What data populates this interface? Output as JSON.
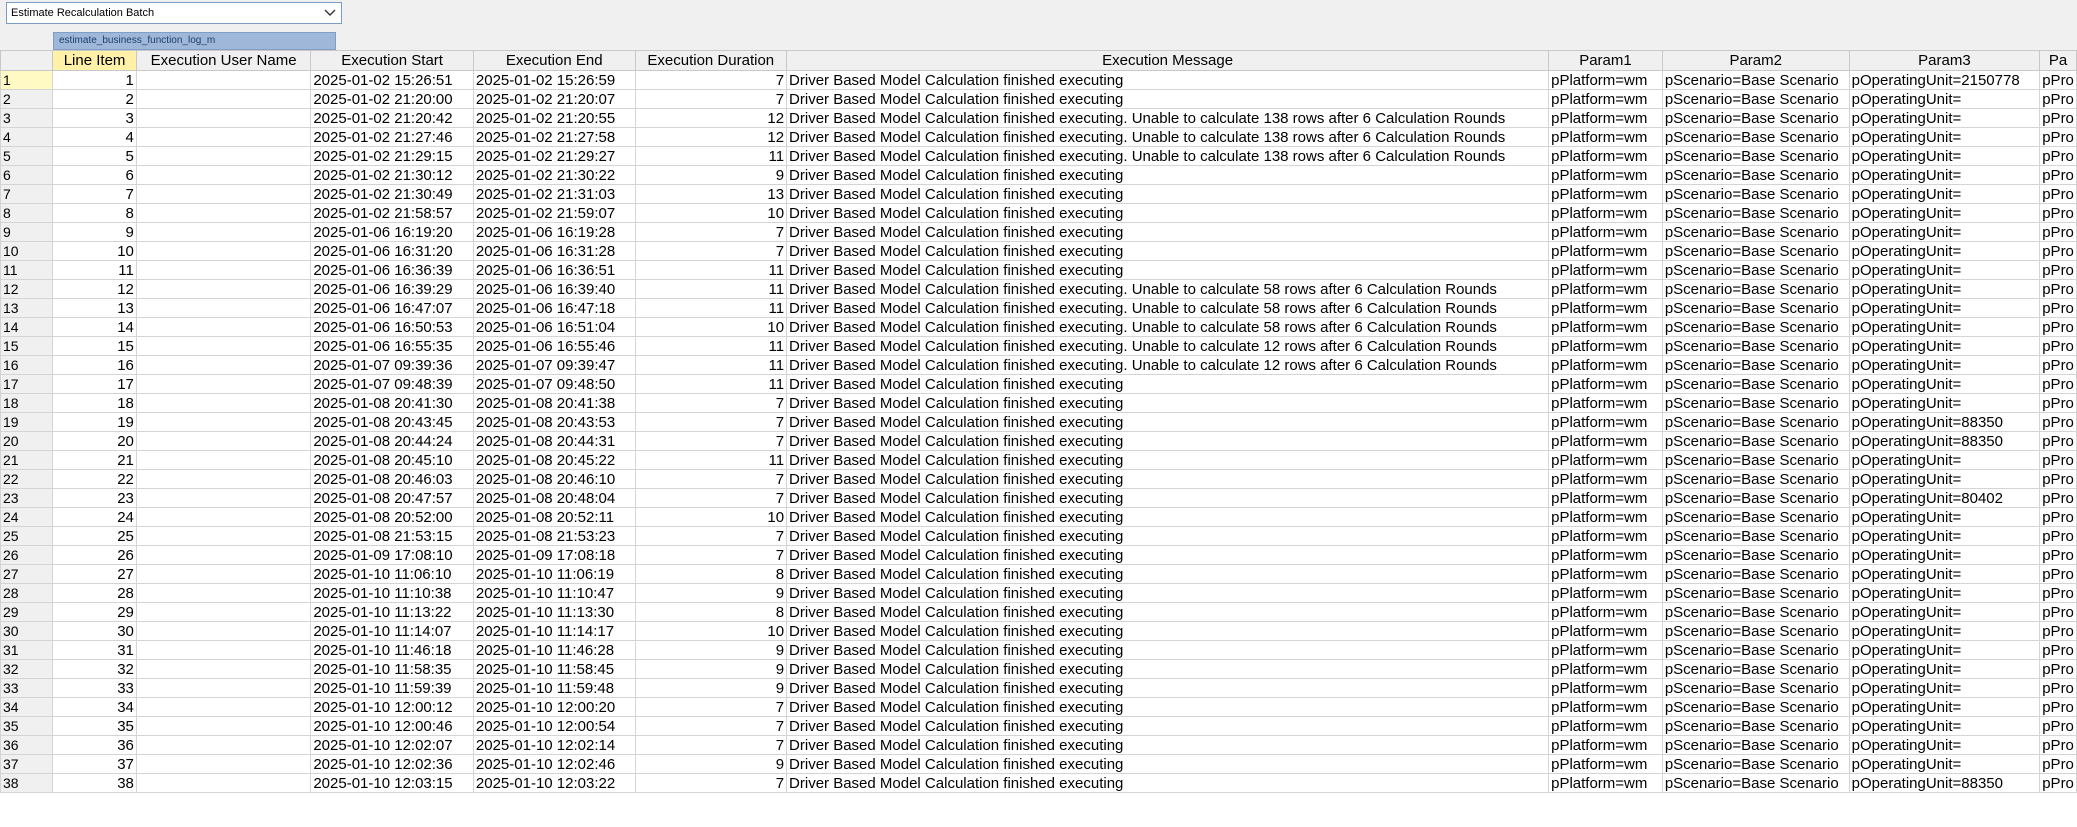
{
  "combo": {
    "value": "Estimate Recalculation Batch"
  },
  "sheet_tab": {
    "label": "estimate_business_function_log_m"
  },
  "columns": [
    "",
    "Line Item",
    "Execution User Name",
    "Execution Start",
    "Execution End",
    "Execution Duration",
    "Execution Message",
    "Param1",
    "Param2",
    "Param3",
    "Pa"
  ],
  "rows": [
    [
      "1",
      "1",
      "",
      "2025-01-02 15:26:51",
      "2025-01-02 15:26:59",
      "7",
      "Driver Based Model Calculation finished executing",
      "pPlatform=wm",
      "pScenario=Base Scenario",
      "pOperatingUnit=2150778",
      "pPro"
    ],
    [
      "2",
      "2",
      "",
      "2025-01-02 21:20:00",
      "2025-01-02 21:20:07",
      "7",
      "Driver Based Model Calculation finished executing",
      "pPlatform=wm",
      "pScenario=Base Scenario",
      "pOperatingUnit=",
      "pPro"
    ],
    [
      "3",
      "3",
      "",
      "2025-01-02 21:20:42",
      "2025-01-02 21:20:55",
      "12",
      "Driver Based Model Calculation finished executing. Unable to calculate 138 rows after 6 Calculation Rounds",
      "pPlatform=wm",
      "pScenario=Base Scenario",
      "pOperatingUnit=",
      "pPro"
    ],
    [
      "4",
      "4",
      "",
      "2025-01-02 21:27:46",
      "2025-01-02 21:27:58",
      "12",
      "Driver Based Model Calculation finished executing. Unable to calculate 138 rows after 6 Calculation Rounds",
      "pPlatform=wm",
      "pScenario=Base Scenario",
      "pOperatingUnit=",
      "pPro"
    ],
    [
      "5",
      "5",
      "",
      "2025-01-02 21:29:15",
      "2025-01-02 21:29:27",
      "11",
      "Driver Based Model Calculation finished executing. Unable to calculate 138 rows after 6 Calculation Rounds",
      "pPlatform=wm",
      "pScenario=Base Scenario",
      "pOperatingUnit=",
      "pPro"
    ],
    [
      "6",
      "6",
      "",
      "2025-01-02 21:30:12",
      "2025-01-02 21:30:22",
      "9",
      "Driver Based Model Calculation finished executing",
      "pPlatform=wm",
      "pScenario=Base Scenario",
      "pOperatingUnit=",
      "pPro"
    ],
    [
      "7",
      "7",
      "",
      "2025-01-02 21:30:49",
      "2025-01-02 21:31:03",
      "13",
      "Driver Based Model Calculation finished executing",
      "pPlatform=wm",
      "pScenario=Base Scenario",
      "pOperatingUnit=",
      "pPro"
    ],
    [
      "8",
      "8",
      "",
      "2025-01-02 21:58:57",
      "2025-01-02 21:59:07",
      "10",
      "Driver Based Model Calculation finished executing",
      "pPlatform=wm",
      "pScenario=Base Scenario",
      "pOperatingUnit=",
      "pPro"
    ],
    [
      "9",
      "9",
      "",
      "2025-01-06 16:19:20",
      "2025-01-06 16:19:28",
      "7",
      "Driver Based Model Calculation finished executing",
      "pPlatform=wm",
      "pScenario=Base Scenario",
      "pOperatingUnit=",
      "pPro"
    ],
    [
      "10",
      "10",
      "",
      "2025-01-06 16:31:20",
      "2025-01-06 16:31:28",
      "7",
      "Driver Based Model Calculation finished executing",
      "pPlatform=wm",
      "pScenario=Base Scenario",
      "pOperatingUnit=",
      "pPro"
    ],
    [
      "11",
      "11",
      "",
      "2025-01-06 16:36:39",
      "2025-01-06 16:36:51",
      "11",
      "Driver Based Model Calculation finished executing",
      "pPlatform=wm",
      "pScenario=Base Scenario",
      "pOperatingUnit=",
      "pPro"
    ],
    [
      "12",
      "12",
      "",
      "2025-01-06 16:39:29",
      "2025-01-06 16:39:40",
      "11",
      "Driver Based Model Calculation finished executing. Unable to calculate 58 rows after 6 Calculation Rounds",
      "pPlatform=wm",
      "pScenario=Base Scenario",
      "pOperatingUnit=",
      "pPro"
    ],
    [
      "13",
      "13",
      "",
      "2025-01-06 16:47:07",
      "2025-01-06 16:47:18",
      "11",
      "Driver Based Model Calculation finished executing. Unable to calculate 58 rows after 6 Calculation Rounds",
      "pPlatform=wm",
      "pScenario=Base Scenario",
      "pOperatingUnit=",
      "pPro"
    ],
    [
      "14",
      "14",
      "",
      "2025-01-06 16:50:53",
      "2025-01-06 16:51:04",
      "10",
      "Driver Based Model Calculation finished executing. Unable to calculate 58 rows after 6 Calculation Rounds",
      "pPlatform=wm",
      "pScenario=Base Scenario",
      "pOperatingUnit=",
      "pPro"
    ],
    [
      "15",
      "15",
      "",
      "2025-01-06 16:55:35",
      "2025-01-06 16:55:46",
      "11",
      "Driver Based Model Calculation finished executing. Unable to calculate 12 rows after 6 Calculation Rounds",
      "pPlatform=wm",
      "pScenario=Base Scenario",
      "pOperatingUnit=",
      "pPro"
    ],
    [
      "16",
      "16",
      "",
      "2025-01-07 09:39:36",
      "2025-01-07 09:39:47",
      "11",
      "Driver Based Model Calculation finished executing. Unable to calculate 12 rows after 6 Calculation Rounds",
      "pPlatform=wm",
      "pScenario=Base Scenario",
      "pOperatingUnit=",
      "pPro"
    ],
    [
      "17",
      "17",
      "",
      "2025-01-07 09:48:39",
      "2025-01-07 09:48:50",
      "11",
      "Driver Based Model Calculation finished executing",
      "pPlatform=wm",
      "pScenario=Base Scenario",
      "pOperatingUnit=",
      "pPro"
    ],
    [
      "18",
      "18",
      "",
      "2025-01-08 20:41:30",
      "2025-01-08 20:41:38",
      "7",
      "Driver Based Model Calculation finished executing",
      "pPlatform=wm",
      "pScenario=Base Scenario",
      "pOperatingUnit=",
      "pPro"
    ],
    [
      "19",
      "19",
      "",
      "2025-01-08 20:43:45",
      "2025-01-08 20:43:53",
      "7",
      "Driver Based Model Calculation finished executing",
      "pPlatform=wm",
      "pScenario=Base Scenario",
      "pOperatingUnit=88350",
      "pPro"
    ],
    [
      "20",
      "20",
      "",
      "2025-01-08 20:44:24",
      "2025-01-08 20:44:31",
      "7",
      "Driver Based Model Calculation finished executing",
      "pPlatform=wm",
      "pScenario=Base Scenario",
      "pOperatingUnit=88350",
      "pPro"
    ],
    [
      "21",
      "21",
      "",
      "2025-01-08 20:45:10",
      "2025-01-08 20:45:22",
      "11",
      "Driver Based Model Calculation finished executing",
      "pPlatform=wm",
      "pScenario=Base Scenario",
      "pOperatingUnit=",
      "pPro"
    ],
    [
      "22",
      "22",
      "",
      "2025-01-08 20:46:03",
      "2025-01-08 20:46:10",
      "7",
      "Driver Based Model Calculation finished executing",
      "pPlatform=wm",
      "pScenario=Base Scenario",
      "pOperatingUnit=",
      "pPro"
    ],
    [
      "23",
      "23",
      "",
      "2025-01-08 20:47:57",
      "2025-01-08 20:48:04",
      "7",
      "Driver Based Model Calculation finished executing",
      "pPlatform=wm",
      "pScenario=Base Scenario",
      "pOperatingUnit=80402",
      "pPro"
    ],
    [
      "24",
      "24",
      "",
      "2025-01-08 20:52:00",
      "2025-01-08 20:52:11",
      "10",
      "Driver Based Model Calculation finished executing",
      "pPlatform=wm",
      "pScenario=Base Scenario",
      "pOperatingUnit=",
      "pPro"
    ],
    [
      "25",
      "25",
      "",
      "2025-01-08 21:53:15",
      "2025-01-08 21:53:23",
      "7",
      "Driver Based Model Calculation finished executing",
      "pPlatform=wm",
      "pScenario=Base Scenario",
      "pOperatingUnit=",
      "pPro"
    ],
    [
      "26",
      "26",
      "",
      "2025-01-09 17:08:10",
      "2025-01-09 17:08:18",
      "7",
      "Driver Based Model Calculation finished executing",
      "pPlatform=wm",
      "pScenario=Base Scenario",
      "pOperatingUnit=",
      "pPro"
    ],
    [
      "27",
      "27",
      "",
      "2025-01-10 11:06:10",
      "2025-01-10 11:06:19",
      "8",
      "Driver Based Model Calculation finished executing",
      "pPlatform=wm",
      "pScenario=Base Scenario",
      "pOperatingUnit=",
      "pPro"
    ],
    [
      "28",
      "28",
      "",
      "2025-01-10 11:10:38",
      "2025-01-10 11:10:47",
      "9",
      "Driver Based Model Calculation finished executing",
      "pPlatform=wm",
      "pScenario=Base Scenario",
      "pOperatingUnit=",
      "pPro"
    ],
    [
      "29",
      "29",
      "",
      "2025-01-10 11:13:22",
      "2025-01-10 11:13:30",
      "8",
      "Driver Based Model Calculation finished executing",
      "pPlatform=wm",
      "pScenario=Base Scenario",
      "pOperatingUnit=",
      "pPro"
    ],
    [
      "30",
      "30",
      "",
      "2025-01-10 11:14:07",
      "2025-01-10 11:14:17",
      "10",
      "Driver Based Model Calculation finished executing",
      "pPlatform=wm",
      "pScenario=Base Scenario",
      "pOperatingUnit=",
      "pPro"
    ],
    [
      "31",
      "31",
      "",
      "2025-01-10 11:46:18",
      "2025-01-10 11:46:28",
      "9",
      "Driver Based Model Calculation finished executing",
      "pPlatform=wm",
      "pScenario=Base Scenario",
      "pOperatingUnit=",
      "pPro"
    ],
    [
      "32",
      "32",
      "",
      "2025-01-10 11:58:35",
      "2025-01-10 11:58:45",
      "9",
      "Driver Based Model Calculation finished executing",
      "pPlatform=wm",
      "pScenario=Base Scenario",
      "pOperatingUnit=",
      "pPro"
    ],
    [
      "33",
      "33",
      "",
      "2025-01-10 11:59:39",
      "2025-01-10 11:59:48",
      "9",
      "Driver Based Model Calculation finished executing",
      "pPlatform=wm",
      "pScenario=Base Scenario",
      "pOperatingUnit=",
      "pPro"
    ],
    [
      "34",
      "34",
      "",
      "2025-01-10 12:00:12",
      "2025-01-10 12:00:20",
      "7",
      "Driver Based Model Calculation finished executing",
      "pPlatform=wm",
      "pScenario=Base Scenario",
      "pOperatingUnit=",
      "pPro"
    ],
    [
      "35",
      "35",
      "",
      "2025-01-10 12:00:46",
      "2025-01-10 12:00:54",
      "7",
      "Driver Based Model Calculation finished executing",
      "pPlatform=wm",
      "pScenario=Base Scenario",
      "pOperatingUnit=",
      "pPro"
    ],
    [
      "36",
      "36",
      "",
      "2025-01-10 12:02:07",
      "2025-01-10 12:02:14",
      "7",
      "Driver Based Model Calculation finished executing",
      "pPlatform=wm",
      "pScenario=Base Scenario",
      "pOperatingUnit=",
      "pPro"
    ],
    [
      "37",
      "37",
      "",
      "2025-01-10 12:02:36",
      "2025-01-10 12:02:46",
      "9",
      "Driver Based Model Calculation finished executing",
      "pPlatform=wm",
      "pScenario=Base Scenario",
      "pOperatingUnit=",
      "pPro"
    ],
    [
      "38",
      "38",
      "",
      "2025-01-10 12:03:15",
      "2025-01-10 12:03:22",
      "7",
      "Driver Based Model Calculation finished executing",
      "pPlatform=wm",
      "pScenario=Base Scenario",
      "pOperatingUnit=88350",
      "pPro"
    ]
  ]
}
